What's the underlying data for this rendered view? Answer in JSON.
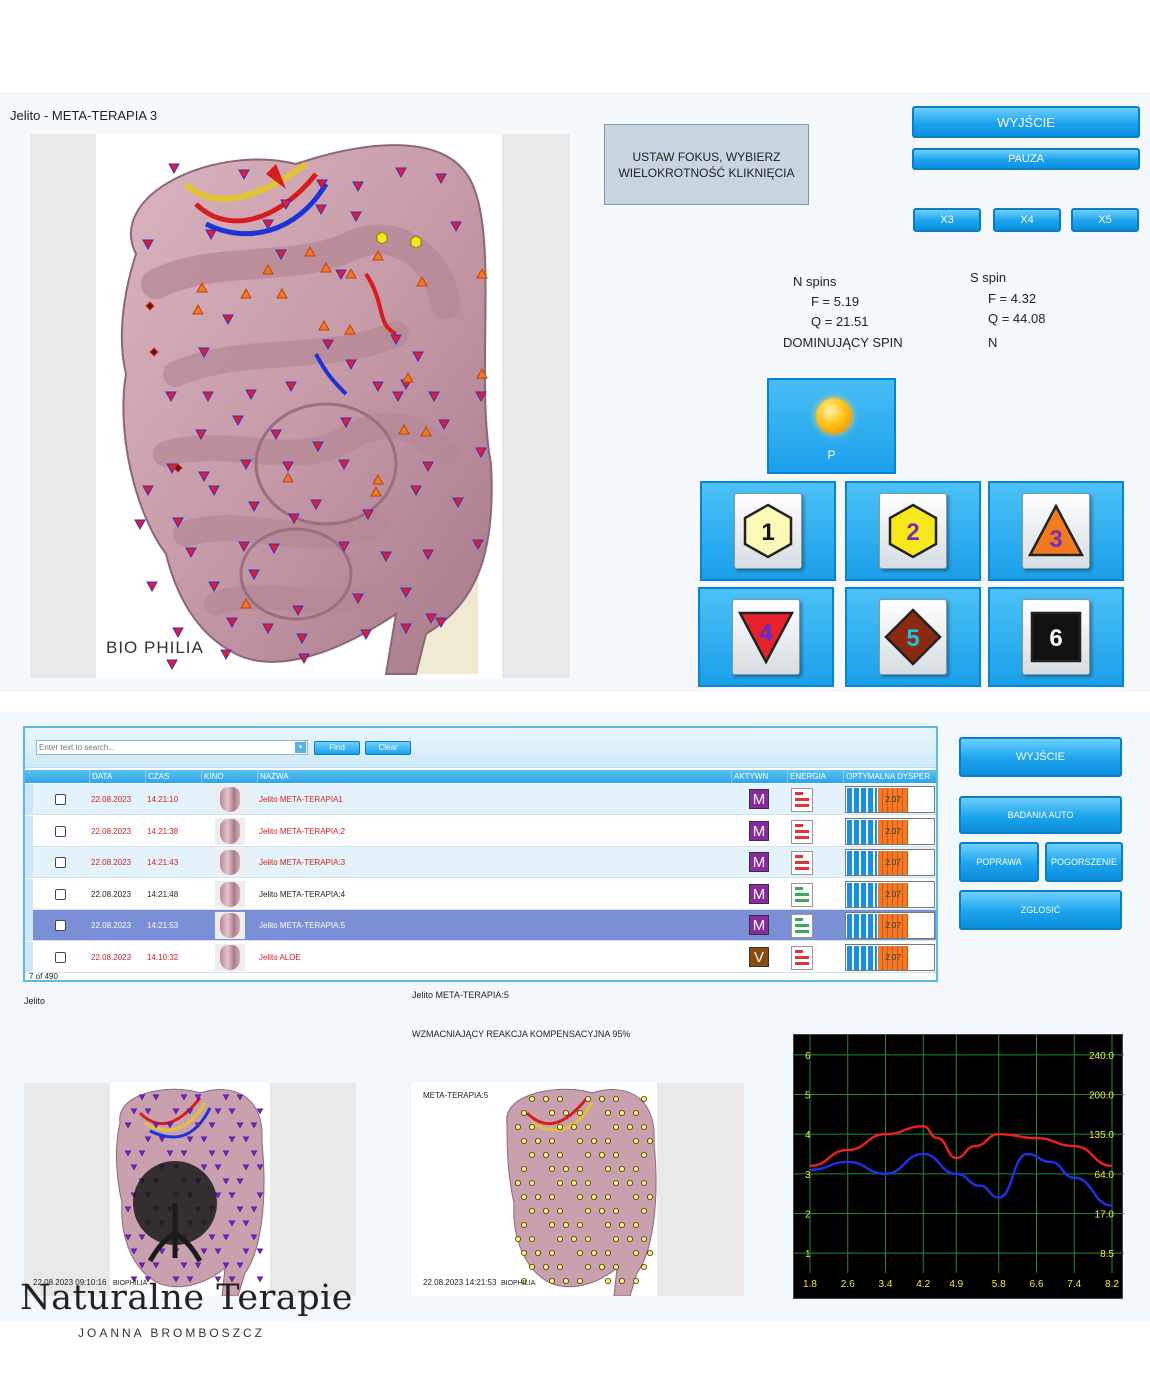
{
  "window": {
    "title": "Jelito - META-TERAPIA 3"
  },
  "organ_image": {
    "brand": "BIO PHILIA"
  },
  "focus_box": {
    "text": "USTAW FOKUS, WYBIERZ WIELOKROTNOŚĆ KLIKNIĘCIA"
  },
  "top_buttons": {
    "exit": "WYJŚCIE",
    "pause": "PAUZA",
    "x3": "X3",
    "x4": "X4",
    "x5": "X5"
  },
  "spins": {
    "n_title": "N spins",
    "n_f": "F =  5.19",
    "n_q": "Q = 21.51",
    "s_title": "S spin",
    "s_f": "F =  4.32",
    "s_q": "Q = 44.08",
    "dominant_label": "DOMINUJĄCY SPIN",
    "dominant_value": "N"
  },
  "sun_tile": {
    "label": "P",
    "icon": "sun-icon"
  },
  "symbols": [
    {
      "number": "1",
      "shape": "hexagon",
      "fill": "#fdf7b8",
      "num_color": "#111111"
    },
    {
      "number": "2",
      "shape": "hexagon",
      "fill": "#f7e81c",
      "num_color": "#7a2fb0"
    },
    {
      "number": "3",
      "shape": "triangle-up",
      "fill": "#f07a20",
      "num_color": "#7a2fb0"
    },
    {
      "number": "4",
      "shape": "triangle-down",
      "fill": "#e8222a",
      "num_color": "#5a2fd0"
    },
    {
      "number": "5",
      "shape": "diamond",
      "fill": "#8b2a12",
      "num_color": "#1ec3e0"
    },
    {
      "number": "6",
      "shape": "square",
      "fill": "#111111",
      "num_color": "#ffffff"
    }
  ],
  "grid": {
    "search_placeholder": "Enter text to search...",
    "find_label": "Find",
    "clear_label": "Clear",
    "columns": [
      "DATA",
      "CZAS",
      "KINO",
      "NAZWA",
      "AKTYWN",
      "ENERGIA",
      "OPTYMALNA DYSPER"
    ],
    "rows": [
      {
        "date": "22.08.2023",
        "time": "14:21:10",
        "name": "Jelito META-TERAPIA1",
        "badge": "M",
        "badge_color": "#8a2aa0",
        "value": "2.07",
        "text_color": "#d42020",
        "bg": "#e4f3fb",
        "energy": "red"
      },
      {
        "date": "22.08.2023",
        "time": "14:21:38",
        "name": "Jelito META-TERAPIA:2",
        "badge": "M",
        "badge_color": "#8a2aa0",
        "value": "2.07",
        "text_color": "#d42020",
        "bg": "#ffffff",
        "energy": "red"
      },
      {
        "date": "22.08.2023",
        "time": "14:21:43",
        "name": "Jelito META-TERAPIA:3",
        "badge": "M",
        "badge_color": "#8a2aa0",
        "value": "2.07",
        "text_color": "#d42020",
        "bg": "#e4f3fb",
        "energy": "red"
      },
      {
        "date": "22.08.2023",
        "time": "14:21:48",
        "name": "Jelito META-TERAPIA:4",
        "badge": "M",
        "badge_color": "#8a2aa0",
        "value": "2.07",
        "text_color": "#222222",
        "bg": "#ffffff",
        "energy": "green"
      },
      {
        "date": "22.08.2023",
        "time": "14:21:53",
        "name": "Jelito META-TERAPIA:5",
        "badge": "M",
        "badge_color": "#8a2aa0",
        "value": "2.07",
        "text_color": "#ffffff",
        "bg": "#7b8fd6",
        "energy": "green"
      },
      {
        "date": "22.08.2023",
        "time": "14:10:32",
        "name": "Jelito ALOE",
        "badge": "V",
        "badge_color": "#8a4a12",
        "value": "2.07",
        "text_color": "#d42020",
        "bg": "#ffffff",
        "energy": "red"
      }
    ],
    "row_count": "7 of 490"
  },
  "side_buttons": {
    "exit": "WYJŚCIE",
    "auto": "BADANIA AUTO",
    "improve": "POPRAWA",
    "worse": "POGORSZENIE",
    "report": "ZGŁOSIĆ"
  },
  "info": {
    "organ": "Jelito",
    "current": "Jelito META-TERAPIA:5",
    "reaction": "WZMACNIAJĄCY REAKCJA KOMPENSACYJNA 95%"
  },
  "mini_left": {
    "timestamp": "22.08.2023 09:10:16",
    "brand": "BIOPHILIA"
  },
  "mini_right": {
    "label": "META-TERAPIA:5",
    "timestamp": "22.08.2023 14:21:53",
    "brand": "BIOPHILIA"
  },
  "chart_data": {
    "type": "line",
    "x": [
      1.8,
      2.6,
      3.4,
      4.2,
      4.9,
      5.8,
      6.6,
      7.4,
      8.2
    ],
    "x_ticks": [
      "1.8",
      "2.6",
      "3.4",
      "4.2",
      "4.9",
      "5.8",
      "6.6",
      "7.4",
      "8.2"
    ],
    "y_left_ticks": [
      "6",
      "5",
      "4",
      "3",
      "2",
      "1"
    ],
    "y_right_ticks": [
      "240.0",
      "200.0",
      "135.0",
      "64.0",
      "17.0",
      "8.5"
    ],
    "ylim": [
      0.5,
      6.5
    ],
    "grid": true,
    "background": "#000000",
    "grid_color": "#1f8a3a",
    "series": [
      {
        "color": "#e82020",
        "x": [
          1.8,
          2.6,
          3.4,
          4.2,
          4.5,
          4.9,
          5.3,
          5.8,
          6.6,
          7.4,
          8.2
        ],
        "values": [
          3.2,
          3.6,
          4.0,
          4.2,
          3.9,
          3.4,
          3.7,
          4.0,
          3.9,
          3.7,
          3.2
        ]
      },
      {
        "color": "#2030e0",
        "x": [
          1.8,
          2.6,
          3.4,
          4.2,
          4.9,
          5.4,
          5.8,
          6.4,
          6.9,
          7.4,
          8.2
        ],
        "values": [
          3.1,
          3.3,
          3.0,
          3.5,
          3.0,
          2.7,
          2.4,
          3.5,
          3.3,
          2.9,
          2.2
        ]
      }
    ]
  },
  "logo": {
    "title": "Naturalne Terapie",
    "subtitle": "JOANNA BROMBOSZCZ"
  }
}
